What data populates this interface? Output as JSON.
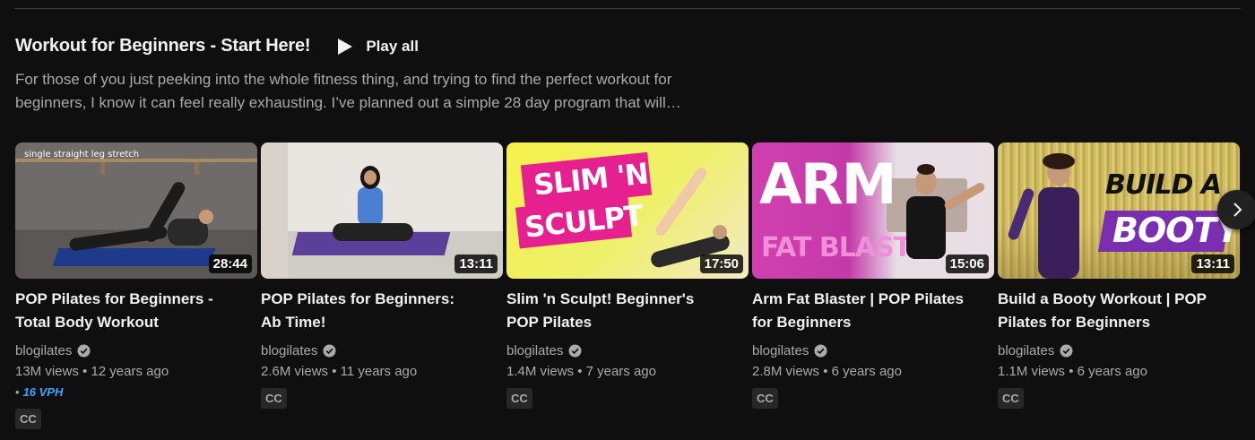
{
  "shelf": {
    "title": "Workout for Beginners - Start Here!",
    "play_all_label": "Play all",
    "description_line1": "For those of you just peeking into the whole fitness thing, and trying to find the perfect workout for",
    "description_line2": "beginners, I know it can feel really exhausting. I’ve planned out a simple 28 day program that will…"
  },
  "icons": {
    "play": "play-icon",
    "verified": "verified-check-icon",
    "next": "chevron-right-icon"
  },
  "colors": {
    "background": "#0f0f0f",
    "primary_text": "#f1f1f1",
    "secondary_text": "#aaaaaa",
    "vph_accent": "#3ea6ff",
    "badge_bg": "#272727"
  },
  "videos": [
    {
      "title_line1": "POP Pilates for Beginners -",
      "title_line2": "Total Body Workout",
      "channel": "blogilates",
      "meta": "13M views • 12 years ago",
      "vph": "16 VPH",
      "badge": "CC",
      "duration": "28:44",
      "thumb_caption": "single straight leg stretch"
    },
    {
      "title_line1": "POP Pilates for Beginners:",
      "title_line2": "Ab Time!",
      "channel": "blogilates",
      "meta": "2.6M views • 11 years ago",
      "badge": "CC",
      "duration": "13:11"
    },
    {
      "title_line1": "Slim 'n Sculpt! Beginner's",
      "title_line2": "POP Pilates",
      "channel": "blogilates",
      "meta": "1.4M views • 7 years ago",
      "badge": "CC",
      "duration": "17:50",
      "thumb_text1": "SLIM 'N",
      "thumb_text2": "SCULPT"
    },
    {
      "title_line1": "Arm Fat Blaster | POP Pilates",
      "title_line2": "for Beginners",
      "channel": "blogilates",
      "meta": "2.8M views • 6 years ago",
      "badge": "CC",
      "duration": "15:06",
      "thumb_text1": "ARM",
      "thumb_text2": "FAT BLAST"
    },
    {
      "title_line1": "Build a Booty Workout | POP",
      "title_line2": "Pilates for Beginners",
      "channel": "blogilates",
      "meta": "1.1M views • 6 years ago",
      "badge": "CC",
      "duration": "13:11",
      "thumb_text1": "BUILD A",
      "thumb_text2": "BOOTY"
    }
  ]
}
